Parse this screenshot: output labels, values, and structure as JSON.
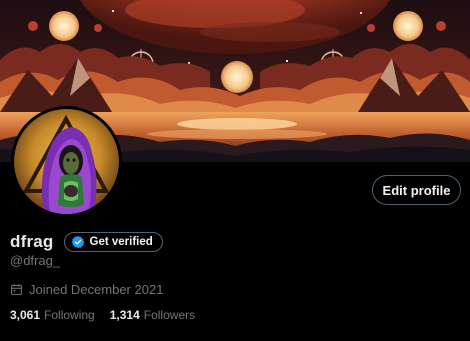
{
  "profile": {
    "display_name": "dfrag",
    "handle": "@dfrag_",
    "joined": "Joined December 2021",
    "verify_label": "Get verified",
    "edit_label": "Edit profile"
  },
  "stats": {
    "following_count": "3,061",
    "following_label": "Following",
    "followers_count": "1,314",
    "followers_label": "Followers"
  },
  "icons": {
    "calendar": "calendar-icon",
    "verified": "verified-badge-icon"
  },
  "colors": {
    "background": "#000000",
    "primary_text": "#e7e9ea",
    "secondary_text": "#71767b",
    "border": "#536471",
    "verified_blue": "#1d9bf0",
    "banner_sky": "#1a0c10",
    "banner_orange": "#e0682e"
  }
}
